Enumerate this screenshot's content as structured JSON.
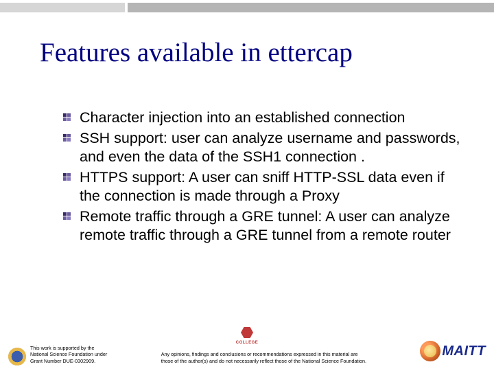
{
  "title": "Features available in ettercap",
  "bullets": [
    "Character injection into an established connection",
    "SSH support: user can analyze username and passwords, and even the data of the SSH1 connection .",
    "HTTPS support: A user can sniff HTTP-SSL data even if the connection is made through a Proxy",
    "Remote traffic through a GRE tunnel: A user can analyze remote traffic through a GRE tunnel from a remote router"
  ],
  "footer": {
    "support_line1": "This work is supported by the",
    "support_line2": "National Science Foundation under",
    "support_line3": "Grant Number DUE-0302909.",
    "disclaimer_line1": "Any opinions, findings and conclusions or recommendations expressed in this material are",
    "disclaimer_line2": "those of the author(s) and do not necessarily reflect those of the National Science Foundation.",
    "mid_logo_text": "COLLEGE",
    "right_logo_text": "MAITT"
  }
}
